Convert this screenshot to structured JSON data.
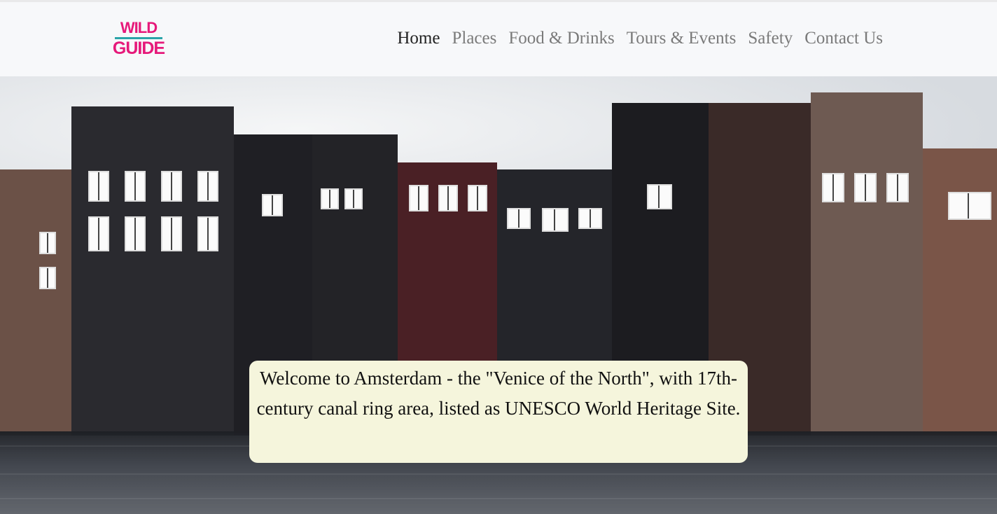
{
  "logo": {
    "line1": "WILD",
    "line2": "GUIDE",
    "color": "#e6197a",
    "accent": "#2aa4a8"
  },
  "nav": {
    "items": [
      {
        "label": "Home",
        "active": true
      },
      {
        "label": "Places",
        "active": false
      },
      {
        "label": "Food & Drinks",
        "active": false
      },
      {
        "label": "Tours & Events",
        "active": false
      },
      {
        "label": "Safety",
        "active": false
      },
      {
        "label": "Contact Us",
        "active": false
      }
    ]
  },
  "hero": {
    "caption": "Welcome to Amsterdam - the \"Venice of the North\", with 17th-century canal ring area, listed as UNESCO World Heritage Site.",
    "caption_bg": "#f5f5dc",
    "image_description_icon": "amsterdam-canal-houses-photo"
  }
}
